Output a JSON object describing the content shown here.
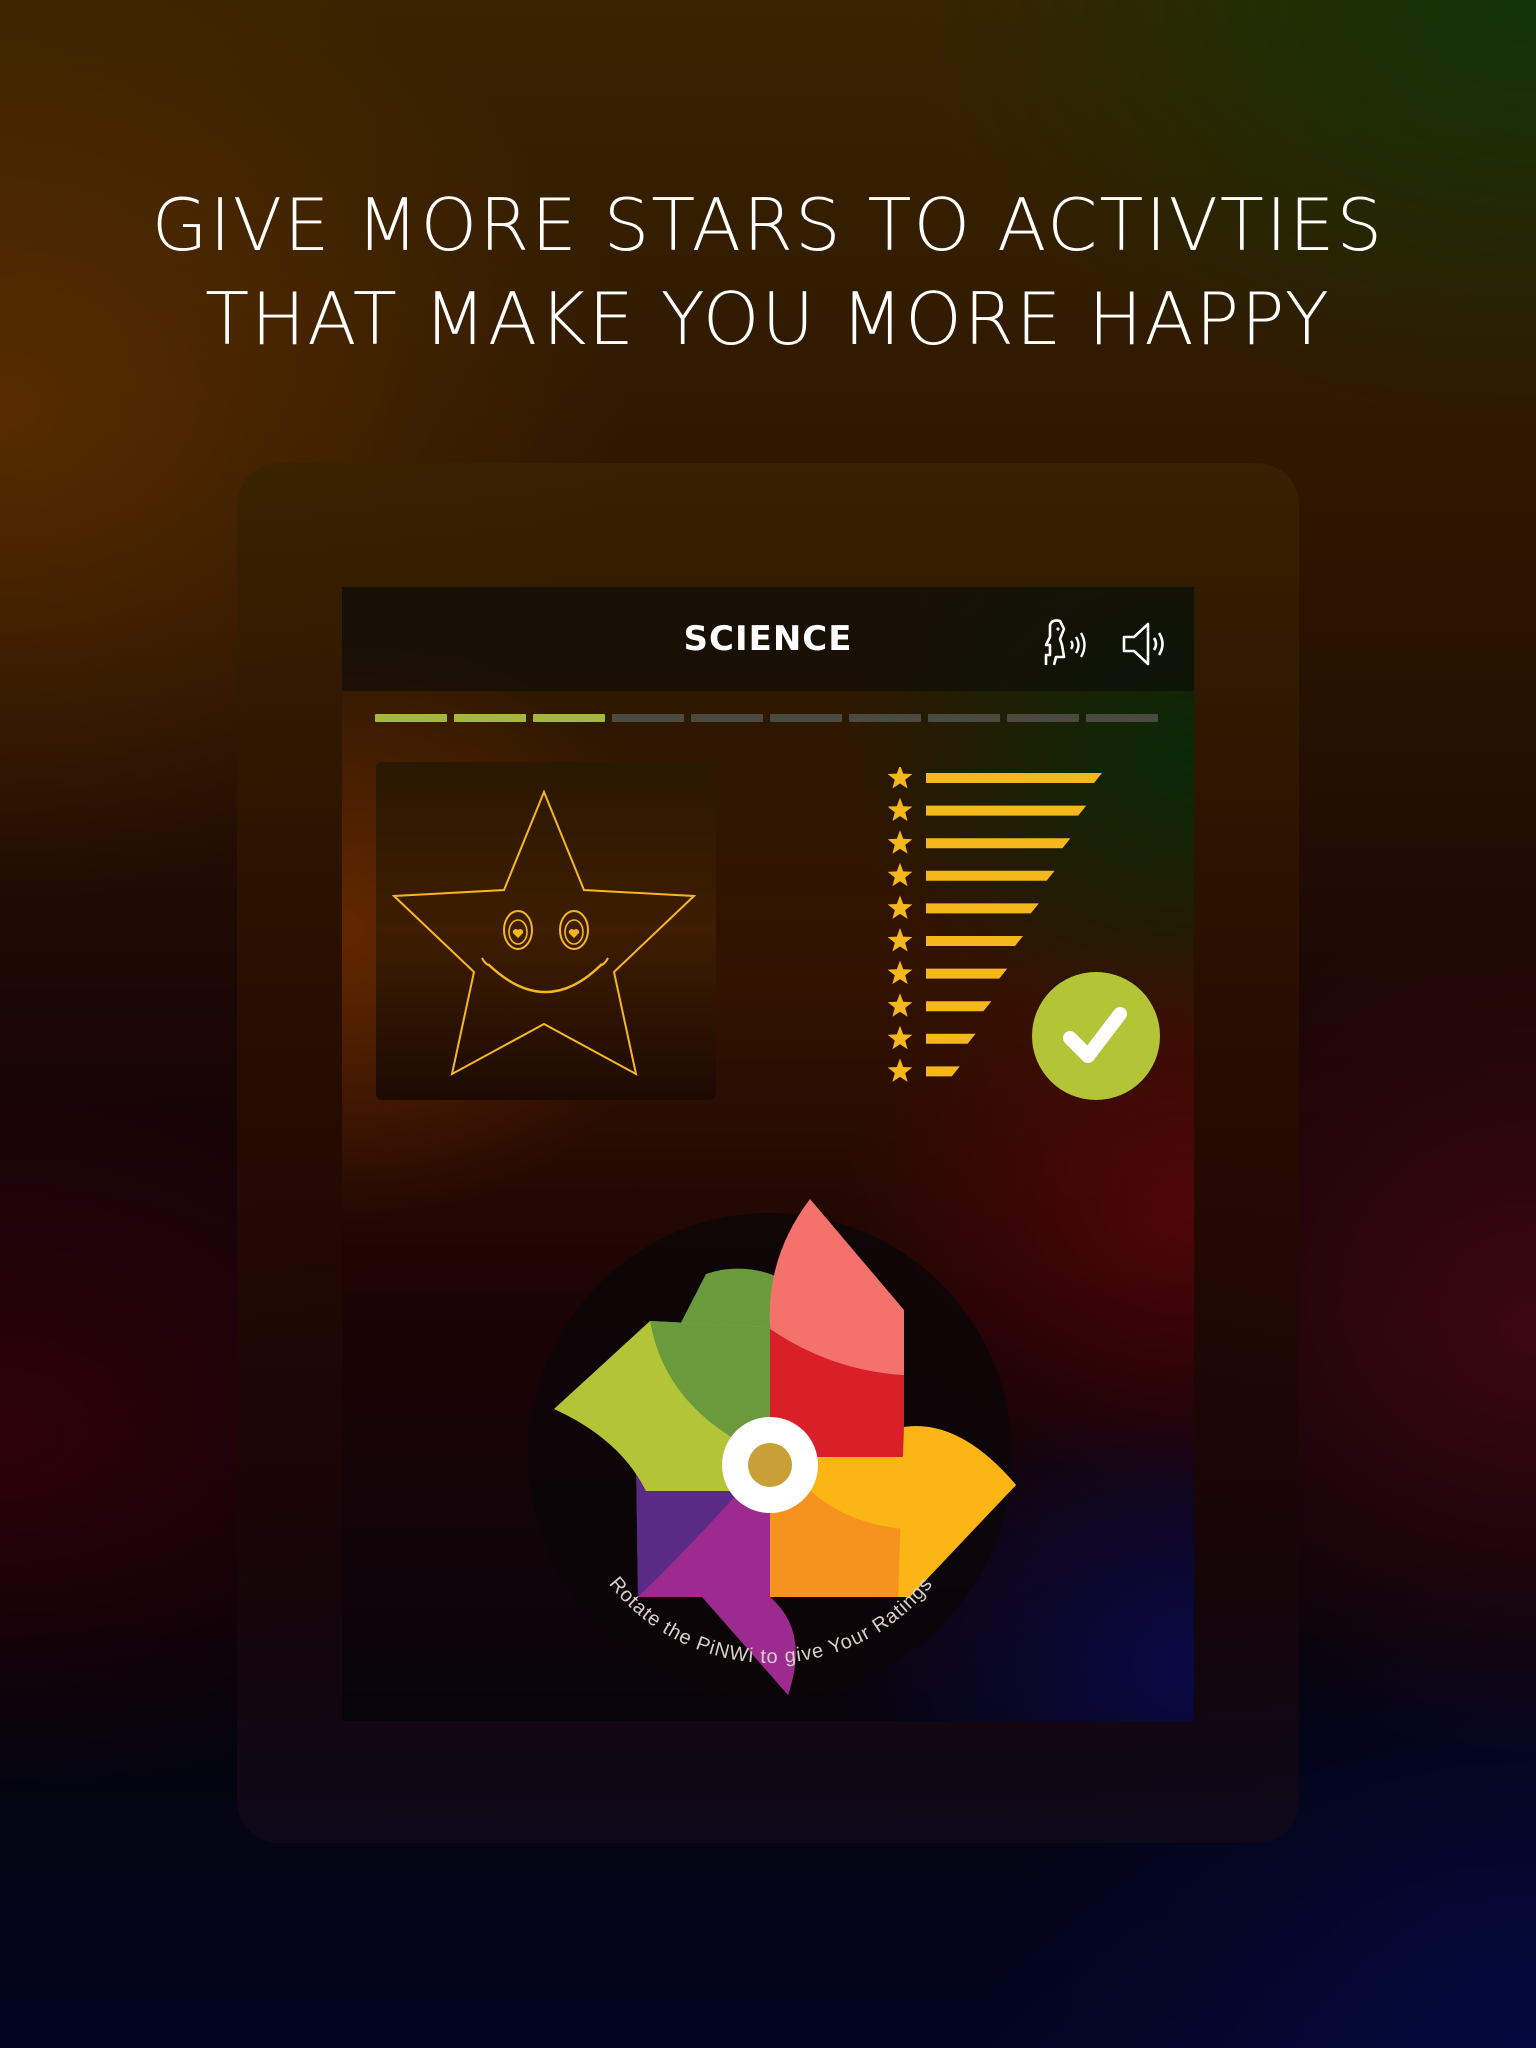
{
  "headline": {
    "line1": "GIVE MORE STARS TO ACTIVTIES",
    "line2": "THAT MAKE YOU MORE HAPPY"
  },
  "screen": {
    "title": "SCIENCE",
    "icons": [
      "speech-icon",
      "speaker-icon"
    ]
  },
  "progress": {
    "total_segments": 10,
    "completed_segments": 3,
    "complete_color": "#a4b83a",
    "incomplete_color": "#4a4a3e"
  },
  "rating": {
    "levels": 10,
    "star_color": "#f5b81c",
    "confirm_icon": "checkmark-icon",
    "confirm_color": "#b3c437"
  },
  "pinwheel": {
    "caption": "Rotate the PiNWi to give Your Ratings",
    "colors": {
      "pink": "#f4716c",
      "red": "#d91f27",
      "yellow": "#fbb615",
      "orange": "#f5931e",
      "magenta": "#9c2a8f",
      "purple": "#5a2b86",
      "lime": "#b3c437",
      "green": "#6a9a3c",
      "hub": "#c9a038"
    }
  }
}
